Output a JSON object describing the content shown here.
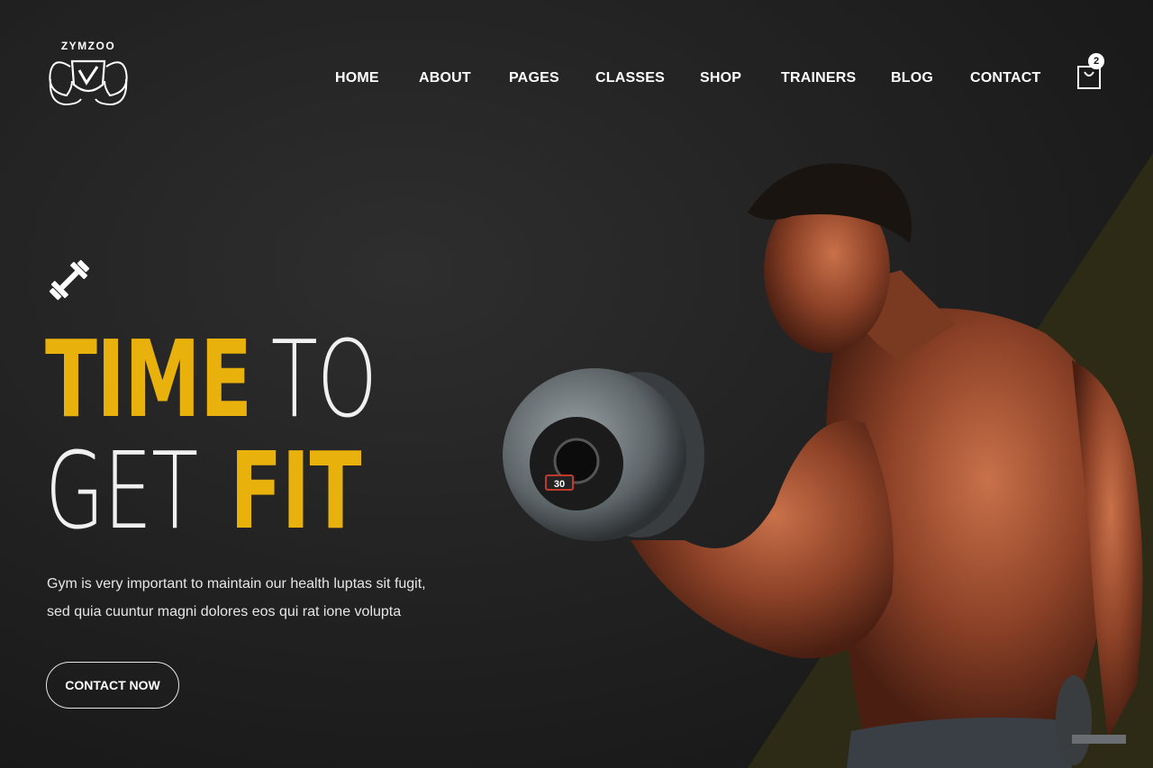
{
  "brand": {
    "name": "ZYMZOO"
  },
  "nav": {
    "items": [
      "HOME",
      "ABOUT",
      "PAGES",
      "CLASSES",
      "SHOP",
      "TRAINERS",
      "BLOG",
      "CONTACT"
    ]
  },
  "cart": {
    "count": "2",
    "icon": "shopping-bag-icon"
  },
  "hero": {
    "title_l1_a": "TIME",
    "title_l1_b": "TO",
    "title_l2_a": "GET",
    "title_l2_b": "FIT",
    "description_l1": "Gym is very important to maintain our health luptas sit fugit,",
    "description_l2": "sed quia cuuntur magni dolores eos qui rat ione volupta",
    "cta_label": "CONTACT NOW",
    "dumbbell_plate_label": "30"
  },
  "colors": {
    "accent": "#e8b10c",
    "background": "#1e1e1e",
    "diagonal": "#2d2b14"
  }
}
